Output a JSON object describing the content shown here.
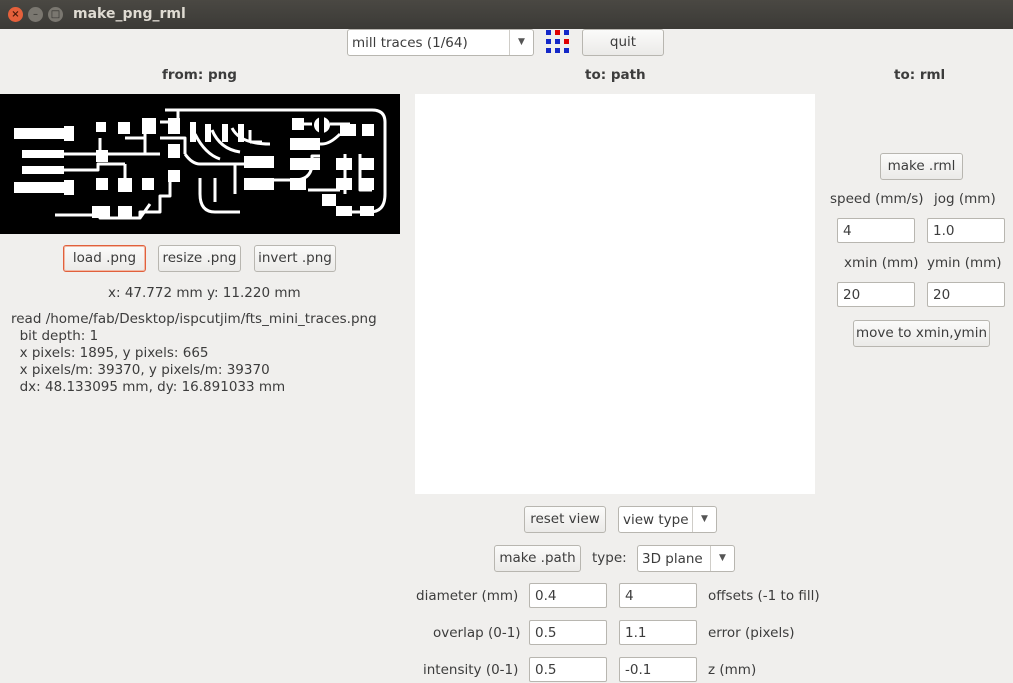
{
  "window": {
    "title": "make_png_rml",
    "close_glyph": "×",
    "min_glyph": "–",
    "max_glyph": "□"
  },
  "toolbar": {
    "process": "mill traces (1/64)",
    "quit": "quit"
  },
  "headings": {
    "from": "from: png",
    "to_path": "to: path",
    "to_rml": "to: rml"
  },
  "png_panel": {
    "load": "load .png",
    "resize": "resize .png",
    "invert": "invert .png",
    "size_readout": "x: 47.772 mm  y: 11.220 mm",
    "info_lines": [
      "read /home/fab/Desktop/ispcutjim/fts_mini_traces.png",
      "  bit depth: 1",
      "  x pixels: 1895, y pixels: 665",
      "  x pixels/m: 39370, y pixels/m: 39370",
      "  dx: 48.133095 mm, dy: 16.891033 mm"
    ]
  },
  "path_panel": {
    "reset_view": "reset view",
    "view_type": "view type",
    "make_path": "make .path",
    "type_label": "type:",
    "type_value": "3D plane",
    "diameter_label": "diameter (mm)",
    "diameter": "0.4",
    "offsets": "4",
    "offsets_label": "offsets (-1 to fill)",
    "overlap_label": "overlap (0-1)",
    "overlap": "0.5",
    "error": "1.1",
    "error_label": "error (pixels)",
    "intensity_label": "intensity (0-1)",
    "intensity": "0.5",
    "z": "-0.1",
    "z_label": "z (mm)"
  },
  "rml_panel": {
    "make_rml": "make .rml",
    "speed_label": "speed (mm/s)",
    "speed": "4",
    "jog_label": "jog (mm)",
    "jog": "1.0",
    "xmin_label": "xmin (mm)",
    "xmin": "20",
    "ymin_label": "ymin (mm)",
    "ymin": "20",
    "move": "move to xmin,ymin"
  },
  "colors": {
    "background": "#f0efed",
    "titlebar": "#3b3a36",
    "close_button": "#e5603b",
    "focus_border": "#e1603c",
    "icon_blue": "#1428c8",
    "icon_red": "#e00000"
  },
  "icons": {
    "close": "close-icon",
    "minimize": "minimize-icon",
    "maximize": "maximize-icon",
    "grid": "grid-icon",
    "dropdown": "chevron-down-icon"
  }
}
